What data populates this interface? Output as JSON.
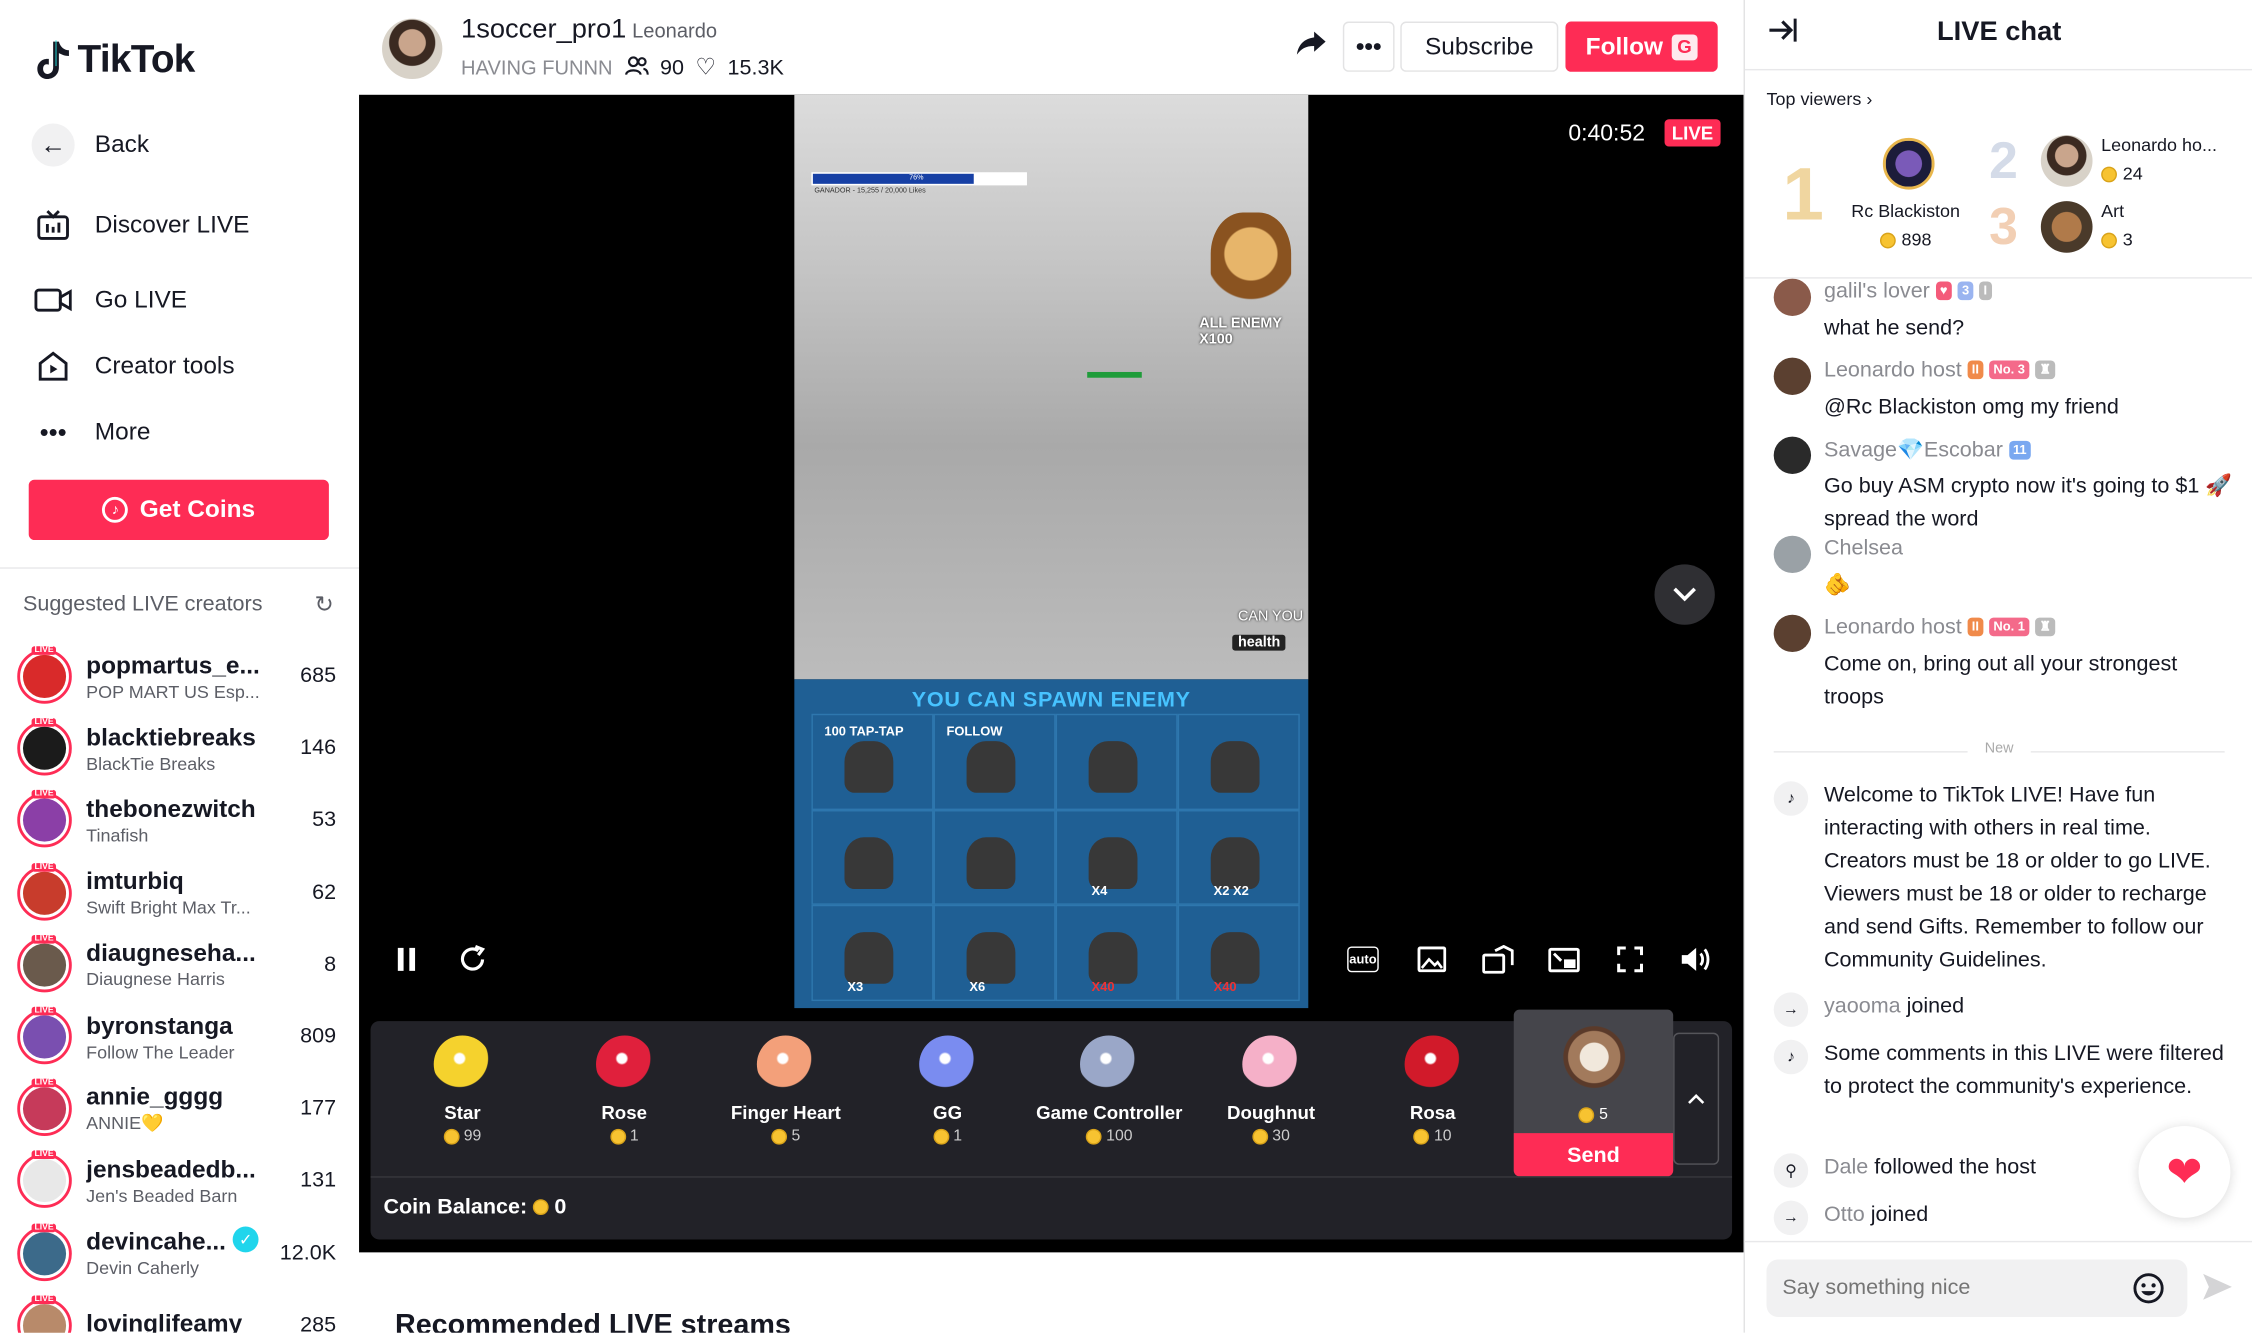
{
  "brand": "TikTok",
  "nav": [
    {
      "label": "Back"
    },
    {
      "label": "Discover LIVE"
    },
    {
      "label": "Go LIVE"
    },
    {
      "label": "Creator tools"
    },
    {
      "label": "More"
    }
  ],
  "get_coins": "Get Coins",
  "suggested_title": "Suggested LIVE creators",
  "creators": [
    {
      "name": "popmartus_e...",
      "sub": "POP MART US Esp...",
      "count": "685",
      "color": "#d92a2a"
    },
    {
      "name": "blacktiebreaks",
      "sub": "BlackTie Breaks",
      "count": "146",
      "color": "#1b1b1b"
    },
    {
      "name": "thebonezwitch",
      "sub": "Tinafish",
      "count": "53",
      "color": "#8b3fa7"
    },
    {
      "name": "imturbiq",
      "sub": "Swift Bright Max Tr...",
      "count": "62",
      "color": "#c83c2c"
    },
    {
      "name": "diaugneseha...",
      "sub": "Diaugnese Harris",
      "count": "8",
      "color": "#6a5a4c"
    },
    {
      "name": "byronstanga",
      "sub": "Follow The Leader",
      "count": "809",
      "color": "#7a4fb0"
    },
    {
      "name": "annie_gggg",
      "sub": "ANNIE💛",
      "count": "177",
      "color": "#c63a5a"
    },
    {
      "name": "jensbeadedb...",
      "sub": "Jen's Beaded Barn",
      "count": "131",
      "color": "#e8e8e8"
    },
    {
      "name": "devincahe...",
      "sub": "Devin Caherly",
      "count": "12.0K",
      "color": "#3c6a8a"
    },
    {
      "name": "lovinglifeamy",
      "sub": "",
      "count": "285",
      "color": "#b88a6a"
    }
  ],
  "host": {
    "username": "1soccer_pro1",
    "nickname": "Leonardo",
    "title": "HAVING FUNNN",
    "viewers": "90",
    "likes": "15.3K"
  },
  "header_buttons": {
    "subscribe": "Subscribe",
    "follow": "Follow",
    "follow_key": "G"
  },
  "video": {
    "timer": "0:40:52",
    "live_badge": "LIVE",
    "health_progress": 0.76,
    "progress_label": "76%",
    "progress_caption": "GANADOR - 15,255 / 20,000 Likes",
    "lion_caption": "ALL ENEMY X100",
    "spawn_title": "YOU CAN SPAWN ENEMY",
    "grid": [
      {
        "label": "100 TAP-TAP",
        "mult": "",
        "red": false
      },
      {
        "label": "FOLLOW",
        "mult": "",
        "red": false
      },
      {
        "label": "",
        "mult": "",
        "red": false
      },
      {
        "label": "",
        "mult": "",
        "red": false
      },
      {
        "label": "",
        "mult": "",
        "red": false
      },
      {
        "label": "",
        "mult": "",
        "red": false
      },
      {
        "label": "",
        "mult": "X4",
        "red": false
      },
      {
        "label": "",
        "mult": "X2   X2",
        "red": false
      },
      {
        "label": "",
        "mult": "X3",
        "red": false
      },
      {
        "label": "",
        "mult": "X6",
        "red": false
      },
      {
        "label": "",
        "mult": "X40",
        "red": true
      },
      {
        "label": "",
        "mult": "X40",
        "red": true
      }
    ],
    "can_you": "CAN YOU",
    "health": "health"
  },
  "gifts": [
    {
      "name": "Star",
      "price": "99",
      "color": "#f5d22d"
    },
    {
      "name": "Rose",
      "price": "1",
      "color": "#e0203c"
    },
    {
      "name": "Finger Heart",
      "price": "5",
      "color": "#f3a07a"
    },
    {
      "name": "GG",
      "price": "1",
      "color": "#7a8cf0"
    },
    {
      "name": "Game Controller",
      "price": "100",
      "color": "#9aa7c8"
    },
    {
      "name": "Doughnut",
      "price": "30",
      "color": "#f5b0c8"
    },
    {
      "name": "Rosa",
      "price": "10",
      "color": "#d11a2a"
    }
  ],
  "selected_gift": {
    "price": "5",
    "send": "Send"
  },
  "coin_balance_label": "Coin Balance:",
  "coin_balance": "0",
  "recommended_title": "Recommended LIVE streams",
  "chat": {
    "title": "LIVE chat",
    "top_viewers_label": "Top viewers",
    "top": [
      {
        "rank": "1",
        "name": "Rc Blackiston",
        "score": "898"
      },
      {
        "rank": "2",
        "name": "Leonardo ho...",
        "score": "24"
      },
      {
        "rank": "3",
        "name": "Art",
        "score": "3"
      }
    ],
    "messages": [
      {
        "user": "galil's lover",
        "text": "what he send?",
        "color": "#8a5a4a"
      },
      {
        "user": "Leonardo host",
        "text": "@Rc Blackiston omg my friend",
        "color": "#5b4030",
        "badge": "No. 3"
      },
      {
        "user": "Savage💎Escobar",
        "text": "Go buy ASM crypto now it's going to $1 🚀 spread the word",
        "color": "#2a2a2a"
      },
      {
        "user": "Chelsea",
        "text": "🫵",
        "color": "#9aa1a6"
      },
      {
        "user": "Leonardo host",
        "text": "Come on, bring out all your strongest troops",
        "color": "#5b4030",
        "badge": "No. 1"
      }
    ],
    "new_label": "New",
    "system": [
      {
        "text": "Welcome to TikTok LIVE! Have fun interacting with others in real time. Creators must be 18 or older to go LIVE. Viewers must be 18 or older to recharge and send Gifts. Remember to follow our Community Guidelines."
      },
      {
        "user": "yaooma",
        "text": "joined"
      },
      {
        "text": "Some comments in this LIVE were filtered to protect the community's experience."
      },
      {
        "user": "Dale",
        "text": "followed the host"
      },
      {
        "user": "Otto",
        "text": "joined"
      }
    ],
    "input_placeholder": "Say something nice"
  }
}
